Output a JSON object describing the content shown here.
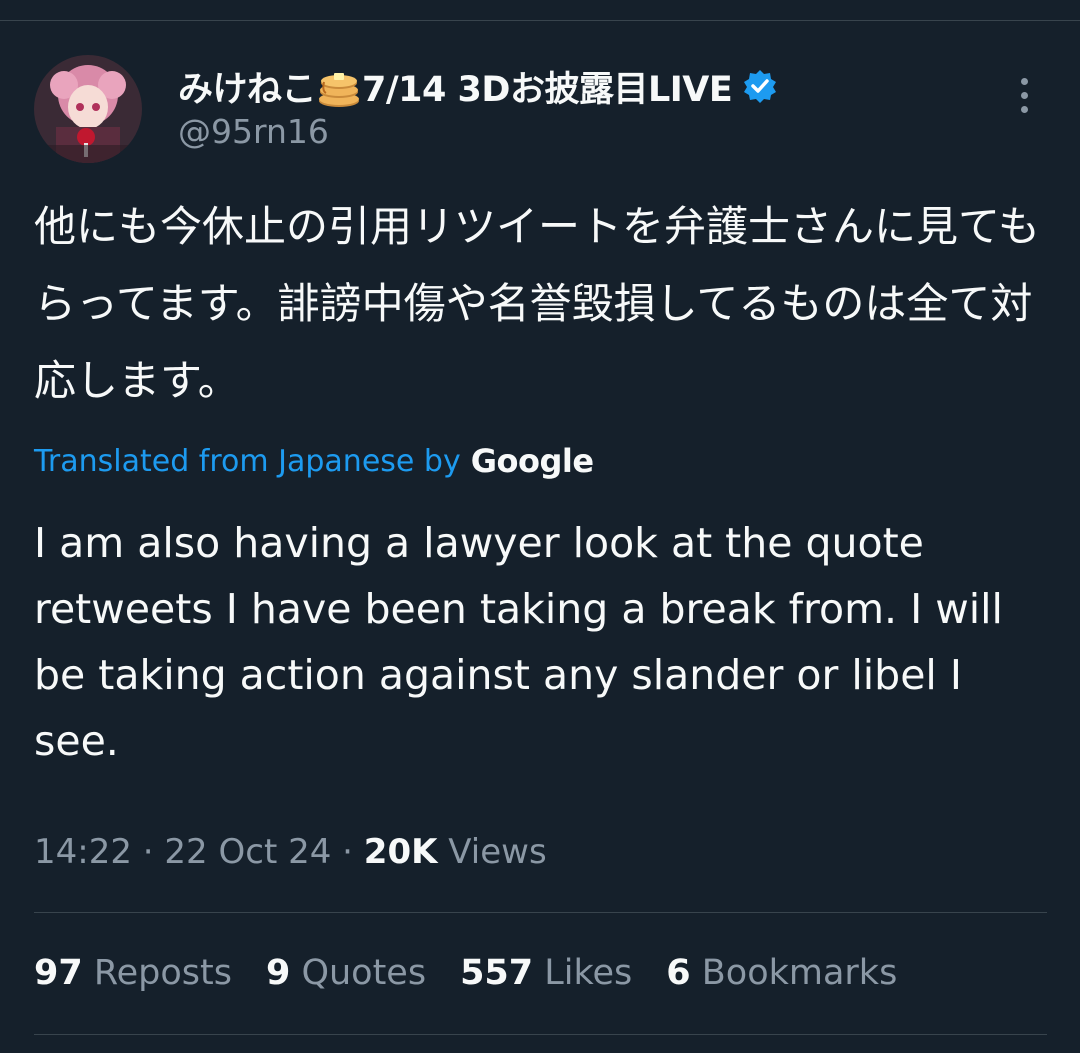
{
  "author": {
    "display_name": "みけねこ",
    "display_name_suffix": "7/14 3Dお披露目LIVE",
    "handle": "@95rn16",
    "verified_icon": "verified-badge-icon"
  },
  "tweet": {
    "text": "他にも今休止の引用リツイートを弁護士さんに見てもらってます。誹謗中傷や名誉毀損してるものは全て対応します。",
    "translated_label": "Translated from Japanese by",
    "translator": "Google",
    "translation": "I am also having a lawyer look at the quote retweets I have been taking a break from. I will be taking action against any slander or libel I see."
  },
  "meta": {
    "time": "14:22",
    "sep1": " · ",
    "date": "22 Oct 24",
    "sep2": " · ",
    "views_count": "20K",
    "views_label": " Views"
  },
  "stats": [
    {
      "count": "97",
      "label": " Reposts"
    },
    {
      "count": "9",
      "label": " Quotes"
    },
    {
      "count": "557",
      "label": " Likes"
    },
    {
      "count": "6",
      "label": " Bookmarks"
    }
  ],
  "colors": {
    "background": "#15202b",
    "text": "#f7f9f9",
    "muted": "#8b98a5",
    "accent": "#1d9bf0",
    "divider": "#38444d"
  }
}
